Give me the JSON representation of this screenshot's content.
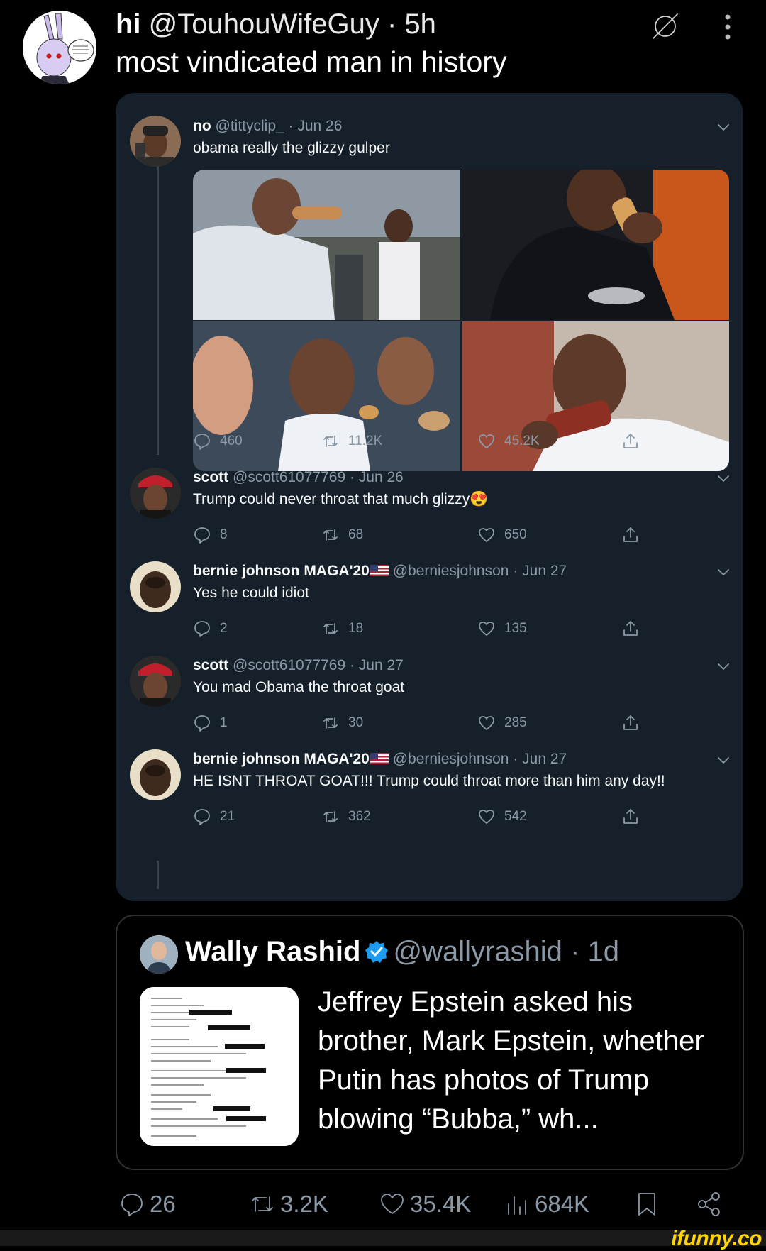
{
  "post": {
    "display_name": "hi",
    "handle": "@TouhouWifeGuy",
    "time": "· 5h",
    "text": "most vindicated man in history"
  },
  "thread": [
    {
      "name": "no",
      "handle": "@tittyclip_",
      "date": "· Jun 26",
      "text": "obama really the glizzy gulper",
      "replies": "460",
      "retweets": "11.2K",
      "likes": "45.2K"
    },
    {
      "name": "scott",
      "handle": "@scott61077769",
      "date": "· Jun 26",
      "text": "Trump could never throat that much glizzy",
      "emoji": "😍",
      "replies": "8",
      "retweets": "68",
      "likes": "650"
    },
    {
      "name": "bernie johnson MAGA'20",
      "handle": "@berniesjohnson",
      "date": "· Jun 27",
      "text": "Yes he could idiot",
      "replies": "2",
      "retweets": "18",
      "likes": "135"
    },
    {
      "name": "scott",
      "handle": "@scott61077769",
      "date": "· Jun 27",
      "text": "You mad Obama the throat goat",
      "replies": "1",
      "retweets": "30",
      "likes": "285"
    },
    {
      "name": "bernie johnson MAGA'20",
      "handle": "@berniesjohnson",
      "date": "· Jun 27",
      "text": "HE ISNT THROAT GOAT!!! Trump could throat more than him any day!!",
      "replies": "21",
      "retweets": "362",
      "likes": "542"
    }
  ],
  "quote": {
    "name": "Wally Rashid",
    "handle": "@wallyrashid",
    "time": "· 1d",
    "text": "Jeffrey Epstein asked his brother, Mark Epstein, whether Putin has photos of Trump blowing “Bubba,” wh..."
  },
  "stats": {
    "replies": "26",
    "reposts": "3.2K",
    "likes": "35.4K",
    "views": "684K"
  },
  "watermark": "ifunny.co",
  "colors": {
    "background": "#000000",
    "card_background": "#15202b",
    "muted_text": "#8b98a5",
    "verified_blue": "#1d9bf0",
    "watermark_yellow": "#ffd400"
  }
}
